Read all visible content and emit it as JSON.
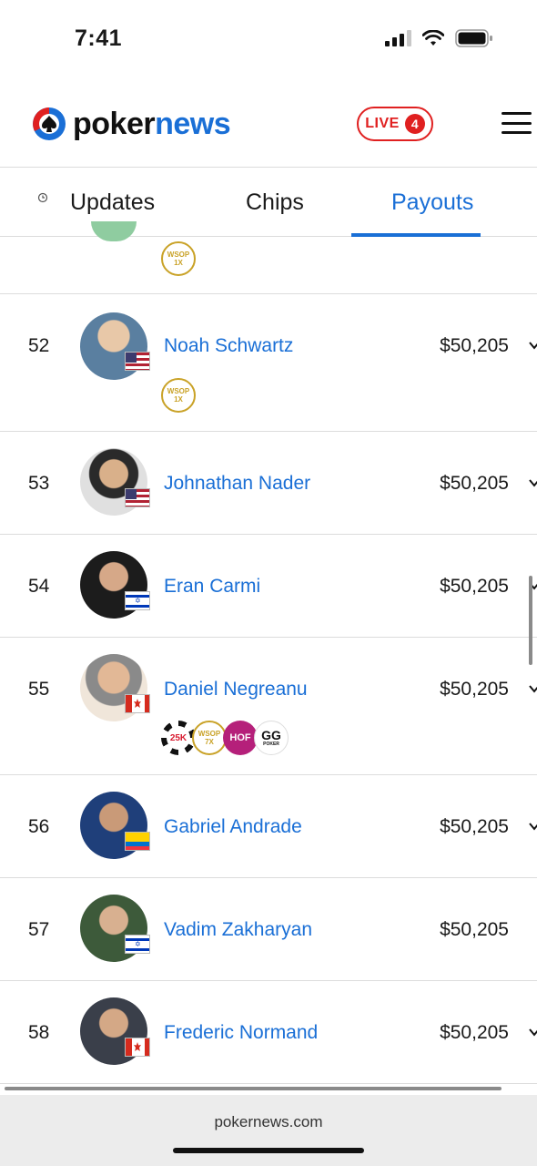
{
  "status_bar": {
    "time": "7:41"
  },
  "header": {
    "logo_poker": "poker",
    "logo_news": "news",
    "live_label": "LIVE",
    "live_count": "4"
  },
  "tabs": [
    {
      "label": "Updates",
      "active": false
    },
    {
      "label": "Chips",
      "active": false
    },
    {
      "label": "Payouts",
      "active": true
    }
  ],
  "partial_row": {
    "badges": [
      {
        "type": "wsop",
        "top": "WSOP",
        "bottom": "1X"
      }
    ]
  },
  "rows": [
    {
      "rank": "52",
      "name": "Noah Schwartz",
      "prize": "$50,205",
      "flag": "us",
      "avatar_color": "#5a7fa0",
      "badges": [
        {
          "type": "wsop",
          "top": "WSOP",
          "bottom": "1X"
        }
      ]
    },
    {
      "rank": "53",
      "name": "Johnathan Nader",
      "prize": "$50,205",
      "flag": "us",
      "avatar_color": "#6b5a4c",
      "badges": []
    },
    {
      "rank": "54",
      "name": "Eran Carmi",
      "prize": "$50,205",
      "flag": "il",
      "avatar_color": "#2c2c2c",
      "badges": []
    },
    {
      "rank": "55",
      "name": "Daniel Negreanu",
      "prize": "$50,205",
      "flag": "ca",
      "avatar_color": "#c9a27a",
      "badges": [
        {
          "type": "chip25",
          "top": "25K"
        },
        {
          "type": "wsop",
          "top": "WSOP",
          "bottom": "7X"
        },
        {
          "type": "hof",
          "top": "HOF"
        },
        {
          "type": "gg",
          "top": "GG",
          "bottom": "POKER"
        }
      ]
    },
    {
      "rank": "56",
      "name": "Gabriel Andrade",
      "prize": "$50,205",
      "flag": "ec",
      "avatar_color": "#1f3f7a",
      "badges": []
    },
    {
      "rank": "57",
      "name": "Vadim Zakharyan",
      "prize": "$50,205",
      "flag": "il",
      "avatar_color": "#3d5a3a",
      "badges": []
    },
    {
      "rank": "58",
      "name": "Frederic Normand",
      "prize": "$50,205",
      "flag": "ca",
      "avatar_color": "#3a3f4a",
      "badges": []
    }
  ],
  "browser": {
    "url": "pokernews.com"
  },
  "colors": {
    "accent": "#1a6fd6",
    "live": "#e02020",
    "wsop_gold": "#c9a227"
  }
}
